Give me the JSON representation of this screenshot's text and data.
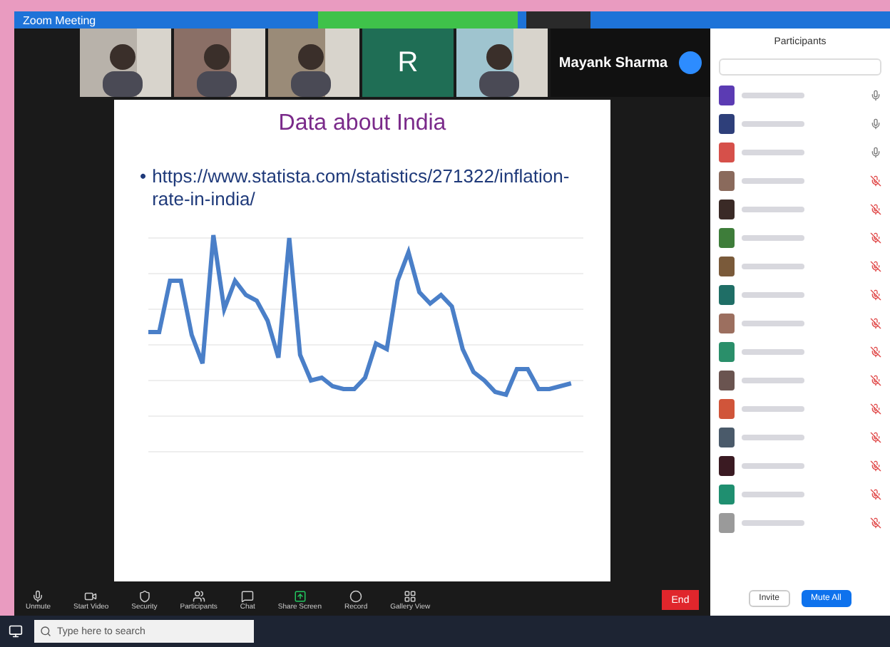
{
  "window": {
    "title": "Zoom Meeting"
  },
  "video_tiles": [
    {
      "kind": "video"
    },
    {
      "kind": "video"
    },
    {
      "kind": "video"
    },
    {
      "kind": "initial",
      "initial": "R",
      "color": "#1f6e55"
    },
    {
      "kind": "video"
    }
  ],
  "speaker": {
    "name": "Mayank Sharma"
  },
  "slide": {
    "title": "Data about India",
    "bullet_mark": "•",
    "bullet": "https://www.statista.com/statistics/271322/inflation-rate-in-india/"
  },
  "participants": {
    "title": "Participants",
    "rows": [
      {
        "color": "#5b3bb3",
        "mic_muted": false
      },
      {
        "color": "#2e3f7a",
        "mic_muted": false
      },
      {
        "color": "#d6504a",
        "mic_muted": false
      },
      {
        "color": "#8a6a5c",
        "mic_muted": true
      },
      {
        "color": "#3a2a26",
        "mic_muted": true
      },
      {
        "color": "#3e7d3a",
        "mic_muted": true
      },
      {
        "color": "#7a5a3a",
        "mic_muted": true
      },
      {
        "color": "#1f6e66",
        "mic_muted": true
      },
      {
        "color": "#9c6f5f",
        "mic_muted": true
      },
      {
        "color": "#2a8f6a",
        "mic_muted": true
      },
      {
        "color": "#6a5450",
        "mic_muted": true
      },
      {
        "color": "#d0553a",
        "mic_muted": true
      },
      {
        "color": "#4a5a6a",
        "mic_muted": true
      },
      {
        "color": "#3a1a22",
        "mic_muted": true
      },
      {
        "color": "#1f8f70",
        "mic_muted": true
      },
      {
        "color": "#9a9a9a",
        "mic_muted": true
      }
    ],
    "buttons": [
      {
        "label": "Invite",
        "primary": false
      },
      {
        "label": "Mute All",
        "primary": true
      }
    ]
  },
  "toolbar": [
    {
      "label": "Unmute"
    },
    {
      "label": "Start Video"
    },
    {
      "label": "Security"
    },
    {
      "label": "Participants"
    },
    {
      "label": "Chat"
    },
    {
      "label": "Share Screen"
    },
    {
      "label": "Record"
    },
    {
      "label": "Gallery View"
    }
  ],
  "end_button": "End",
  "taskbar": {
    "search_placeholder": "Type here to search"
  }
}
